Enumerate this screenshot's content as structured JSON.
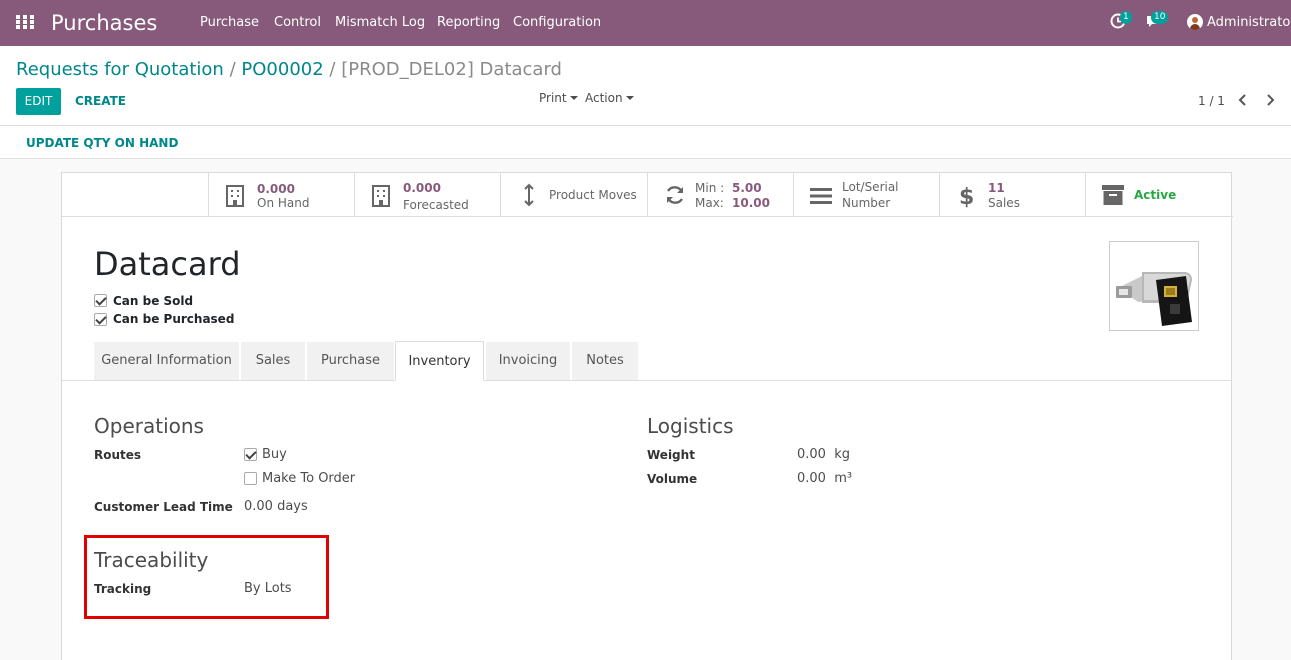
{
  "navbar": {
    "app_title": "Purchases",
    "menu": [
      "Purchase",
      "Control",
      "Mismatch Log",
      "Reporting",
      "Configuration"
    ],
    "activity_count": "1",
    "messages_count": "10",
    "user_name": "Administrator",
    "accent_color": "#875a7b"
  },
  "breadcrumb": {
    "item1": "Requests for Quotation",
    "sep1": "/",
    "item2": "PO00002",
    "sep2": "/",
    "current": "[PROD_DEL02] Datacard"
  },
  "actions": {
    "edit": "EDIT",
    "create": "CREATE",
    "print": "Print",
    "action": "Action",
    "pager": "1 / 1",
    "update_qty": "UPDATE QTY ON HAND"
  },
  "smart_buttons": {
    "on_hand_value": "0.000",
    "on_hand_label": "On Hand",
    "forecasted_value": "0.000",
    "forecasted_label": "Forecasted",
    "product_moves": "Product Moves",
    "min_label": "Min :",
    "min_value": "5.00",
    "max_label": "Max:",
    "max_value": "10.00",
    "lot_label_1": "Lot/Serial",
    "lot_label_2": "Number",
    "sales_value": "11",
    "sales_label": "Sales",
    "active_label": "Active"
  },
  "product": {
    "name": "Datacard",
    "can_be_sold": "Can be Sold",
    "can_be_purchased": "Can be Purchased"
  },
  "tabs": [
    "General Information",
    "Sales",
    "Purchase",
    "Inventory",
    "Invoicing",
    "Notes"
  ],
  "inventory": {
    "operations_title": "Operations",
    "routes_label": "Routes",
    "route_buy": "Buy",
    "route_mto": "Make To Order",
    "lead_time_label": "Customer Lead Time",
    "lead_time_value": "0.00 days",
    "logistics_title": "Logistics",
    "weight_label": "Weight",
    "weight_value": "0.00",
    "weight_unit": "kg",
    "volume_label": "Volume",
    "volume_value": "0.00",
    "volume_unit": "m³",
    "traceability_title": "Traceability",
    "tracking_label": "Tracking",
    "tracking_value": "By Lots"
  }
}
